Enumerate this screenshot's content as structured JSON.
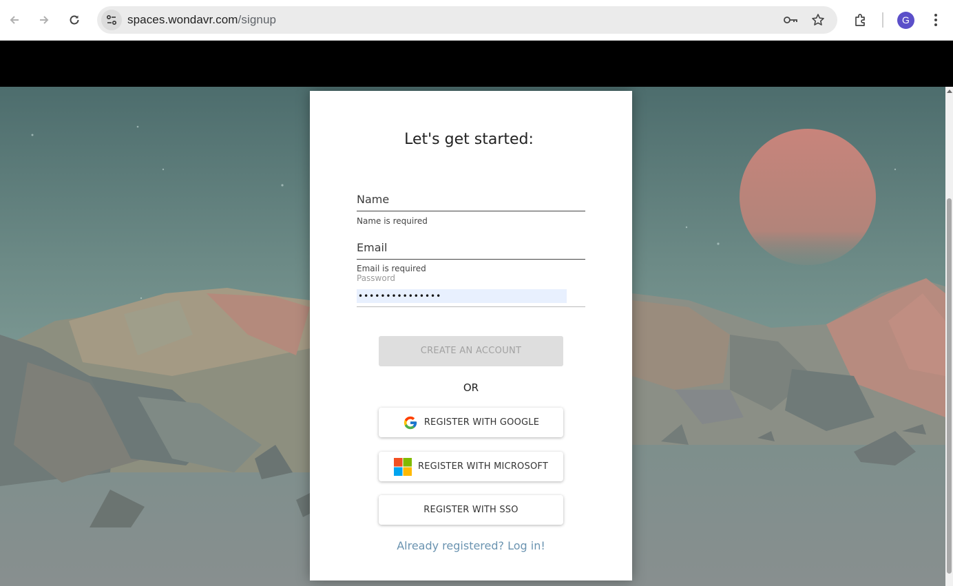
{
  "browser": {
    "url_host": "spaces.wondavr.com",
    "url_path": "/signup",
    "profile_initial": "G",
    "icons": {
      "back": "back-arrow-icon",
      "forward": "forward-arrow-icon",
      "reload": "reload-icon",
      "site_info": "site-info-icon",
      "password_key": "key-icon",
      "bookmark": "star-icon",
      "extensions": "puzzle-icon",
      "menu": "kebab-menu-icon"
    }
  },
  "signup": {
    "title": "Let's get started:",
    "name_label": "Name",
    "name_error": "Name is required",
    "email_label": "Email",
    "email_error": "Email is required",
    "password_label": "Password",
    "password_value": "•••••••••••••••",
    "create_button": "CREATE AN ACCOUNT",
    "or_text": "OR",
    "google_button": "REGISTER WITH GOOGLE",
    "microsoft_button": "REGISTER WITH MICROSOFT",
    "sso_button": "REGISTER WITH SSO",
    "login_link": "Already registered? Log in!"
  },
  "colors": {
    "link": "#6a93b0",
    "disabled_button": "#dedede",
    "autofill": "#e8f0fe",
    "avatar": "#5b4fc9"
  }
}
